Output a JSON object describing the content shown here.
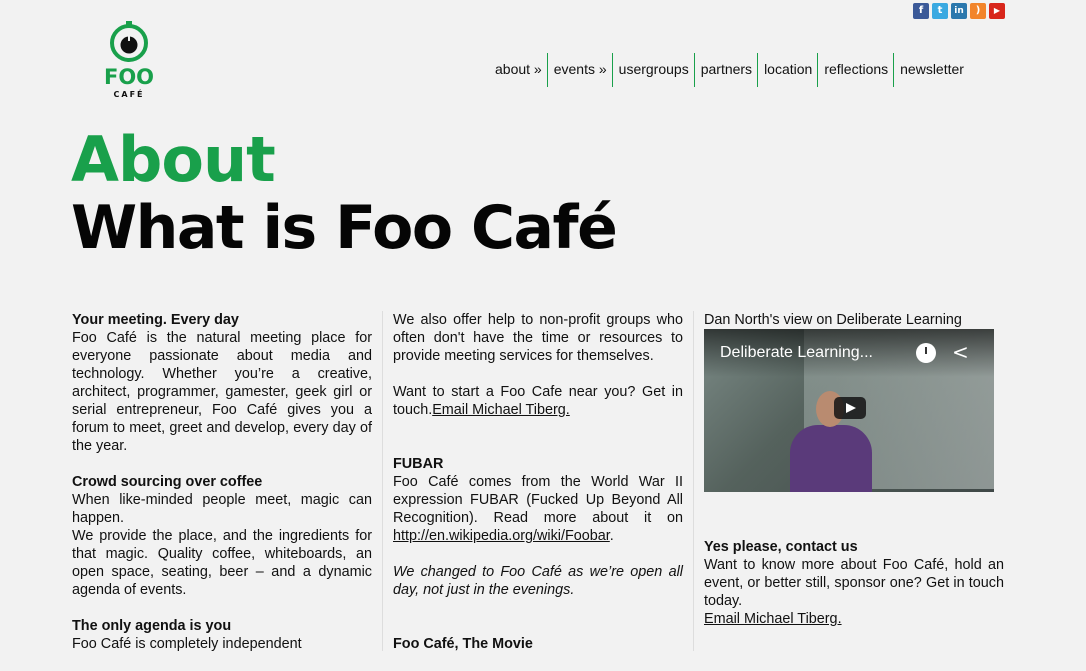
{
  "social": [
    {
      "icon": "facebook-icon",
      "glyph": "f",
      "color": "#3b5998"
    },
    {
      "icon": "twitter-icon",
      "glyph": "t",
      "color": "#3aa9e1"
    },
    {
      "icon": "linkedin-icon",
      "glyph": "in",
      "color": "#2b78ad"
    },
    {
      "icon": "rss-icon",
      "glyph": ")",
      "color": "#f2842a"
    },
    {
      "icon": "youtube-icon",
      "glyph": "▶",
      "color": "#d8261b"
    }
  ],
  "logo": {
    "line1": "FOO",
    "line2": "CAFÉ",
    "color": "#19a04b"
  },
  "nav": {
    "items": [
      "about »",
      "events »",
      "usergroups",
      "partners",
      "location",
      "reflections",
      "newsletter"
    ]
  },
  "heading": {
    "section": "About",
    "title": "What is Foo Café"
  },
  "col1": {
    "h1": "Your meeting. Every day",
    "p1": "Foo Café is the natural meeting place for everyone passionate about media and technology. Whether you’re a creative, architect, programmer, gamester, geek girl or serial entrepreneur, Foo Café gives you a forum to meet, greet and develop, every day of the year.",
    "h2": "Crowd sourcing over coffee",
    "p2a": "When like-minded people meet, magic can happen.",
    "p2b": "We provide the place, and the ingredients for that magic. Quality coffee, whiteboards, an open space, seating, beer – and a dynamic agenda of events.",
    "h3": "The only agenda is you",
    "p3": "Foo Café is completely independent"
  },
  "col2": {
    "p1": "We also offer help to non-profit groups who often don't have the time or resources to provide meeting services for themselves.",
    "p2_text": "Want to start a Foo Cafe near you? Get in touch.",
    "p2_link": "Email Michael Tiberg.",
    "h1": "FUBAR",
    "p3_text": "Foo Café comes from the World War II expression FUBAR (Fucked Up Beyond All Recognition). Read more about it on",
    "p3_link": "http://en.wikipedia.org/wiki/Foobar",
    "p3_end": ".",
    "p4": "We changed to Foo Café as we’re open all day, not just in the evenings.",
    "h2": "Foo Café, The Movie"
  },
  "col3": {
    "video_caption": "Dan North's view on Deliberate Learning",
    "video_title": "Deliberate Learning...",
    "h1": "Yes please, contact us",
    "p1": "Want to know more about Foo Café, hold an event, or better still, sponsor one? Get in touch today.",
    "link": "Email Michael Tiberg."
  }
}
